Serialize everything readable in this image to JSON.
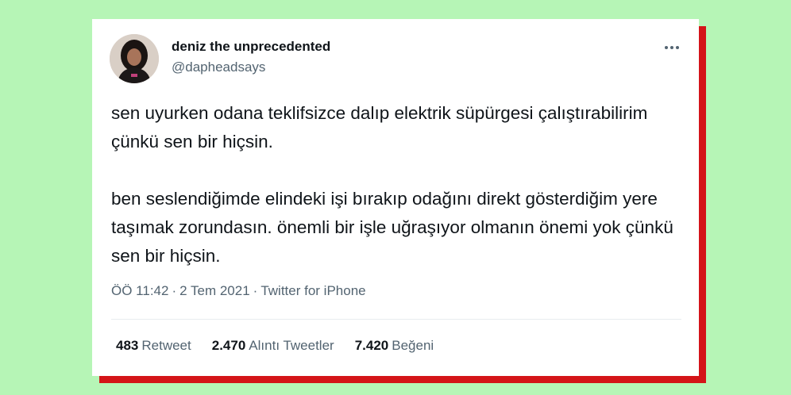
{
  "colors": {
    "background": "#b6f5b6",
    "accent_shadow": "#d41418",
    "card": "#ffffff",
    "primary_text": "#0f1419",
    "secondary_text": "#536471"
  },
  "tweet": {
    "author": {
      "display_name": "deniz the unprecedented",
      "handle": "@dapheadsays",
      "avatar_icon": "profile-photo"
    },
    "more_icon": "more-options-icon",
    "paragraphs": [
      "sen uyurken odana teklifsizce dalıp elektrik süpürgesi çalıştırabilirim çünkü sen bir hiçsin.",
      "ben seslendiğimde elindeki işi bırakıp odağını direkt gösterdiğim yere taşımak zorundasın. önemli bir işle uğraşıyor olmanın önemi yok çünkü sen bir hiçsin."
    ],
    "time": "ÖÖ 11:42",
    "date": "2 Tem 2021",
    "source": "Twitter for iPhone",
    "separator": "·",
    "stats": {
      "retweets": {
        "count": "483",
        "label": "Retweet"
      },
      "quotes": {
        "count": "2.470",
        "label": "Alıntı Tweetler"
      },
      "likes": {
        "count": "7.420",
        "label": "Beğeni"
      }
    }
  }
}
